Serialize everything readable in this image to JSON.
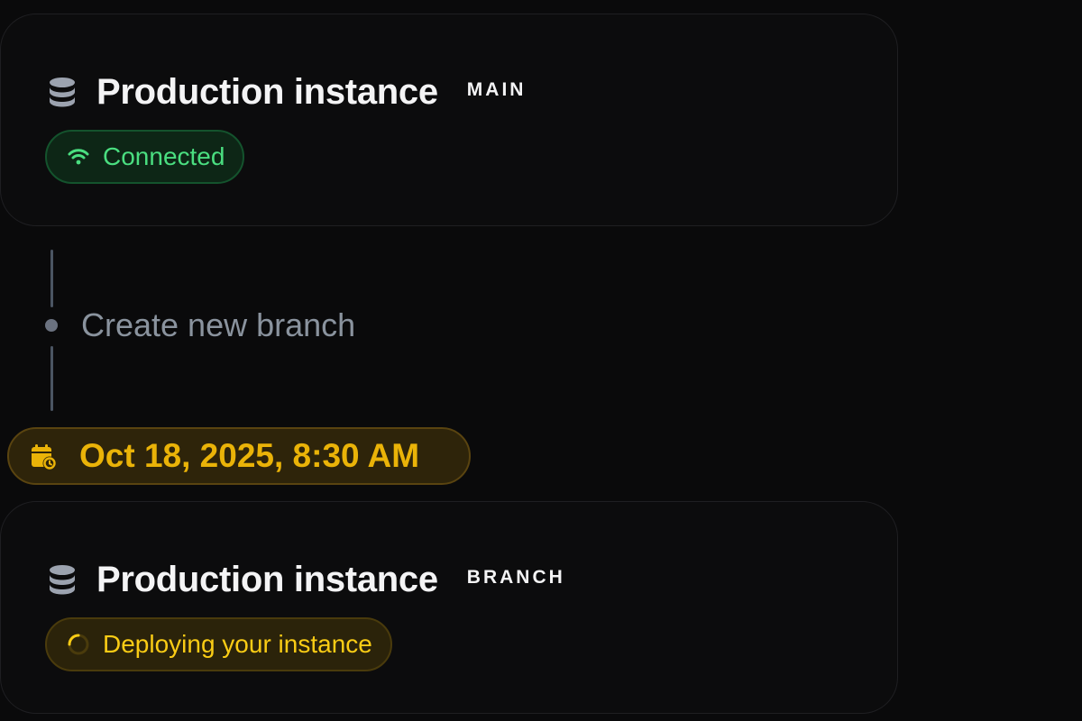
{
  "main_instance": {
    "title": "Production instance",
    "tag": "MAIN",
    "status": {
      "label": "Connected",
      "icon": "wifi-icon",
      "color": "#4ade80"
    },
    "icon": "database-icon"
  },
  "timeline": {
    "action_label": "Create new branch",
    "timestamp": "Oct 18, 2025, 8:30 AM",
    "timestamp_icon": "calendar-clock-icon",
    "accent": "#eab308"
  },
  "branch_instance": {
    "title": "Production instance",
    "tag": "BRANCH",
    "status": {
      "label": "Deploying your instance",
      "icon": "spinner-icon",
      "color": "#facc15"
    },
    "icon": "database-icon"
  }
}
